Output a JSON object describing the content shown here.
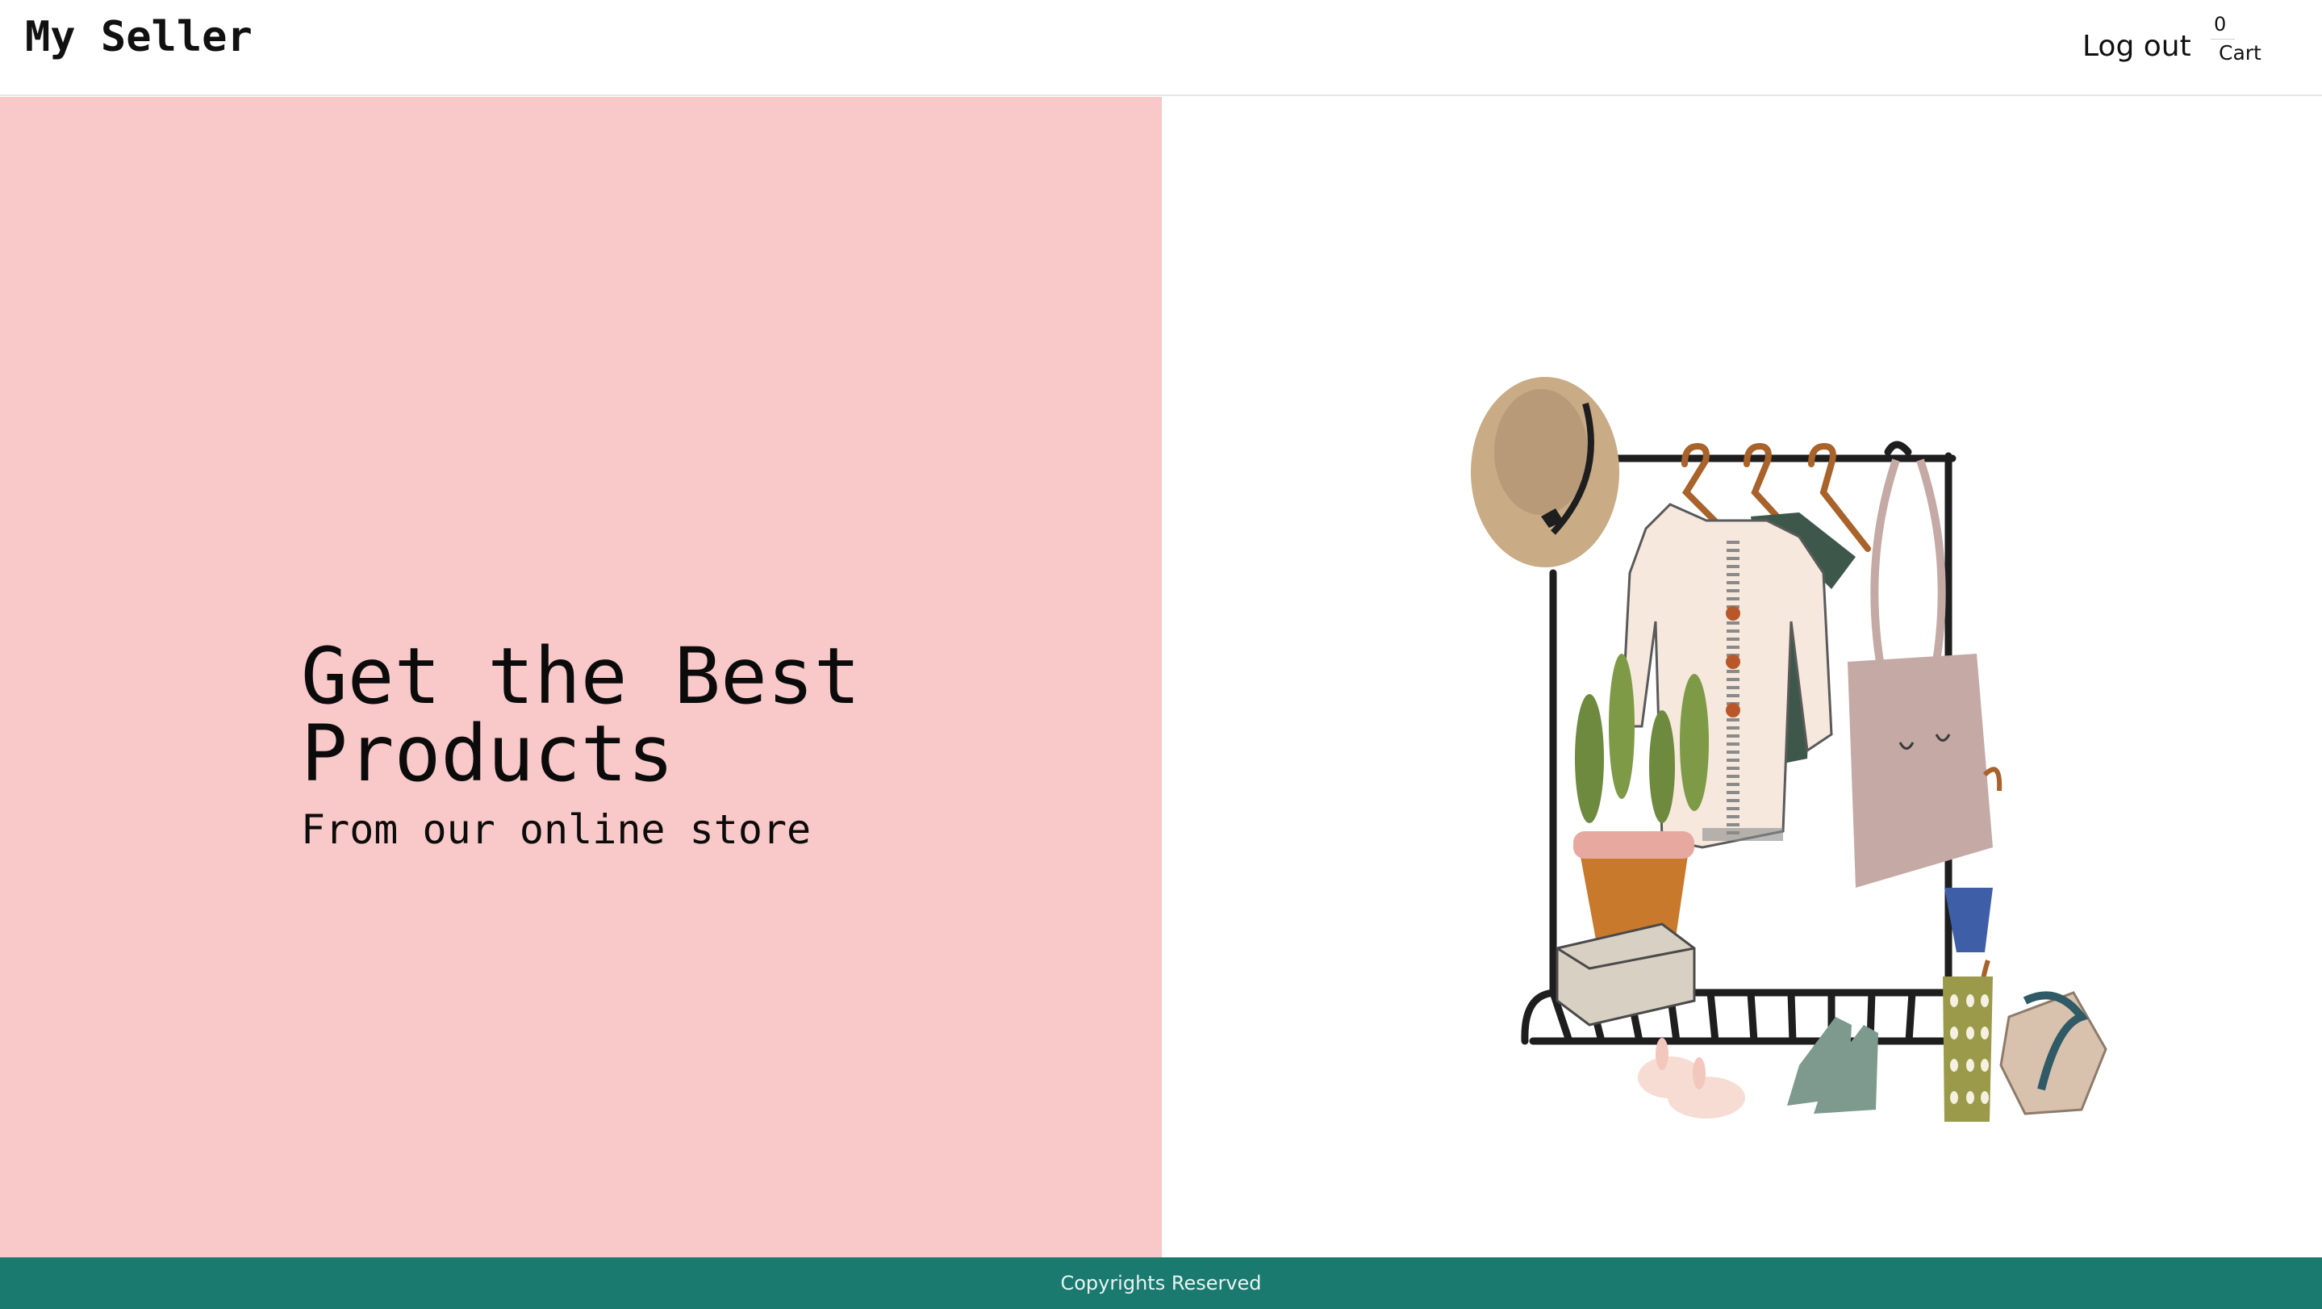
{
  "header": {
    "brand": "My Seller",
    "logout_label": "Log out",
    "cart": {
      "count": "0",
      "label": "Cart"
    }
  },
  "hero": {
    "title": "Get the Best Products",
    "subtitle": "From our online store",
    "illustration_icon": "clothes-rack-illustration"
  },
  "footer": {
    "text": "Copyrights Reserved"
  },
  "colors": {
    "hero_left_bg": "#f9c8c8",
    "footer_bg": "#1a7a70",
    "header_bg": "#ffffff"
  }
}
